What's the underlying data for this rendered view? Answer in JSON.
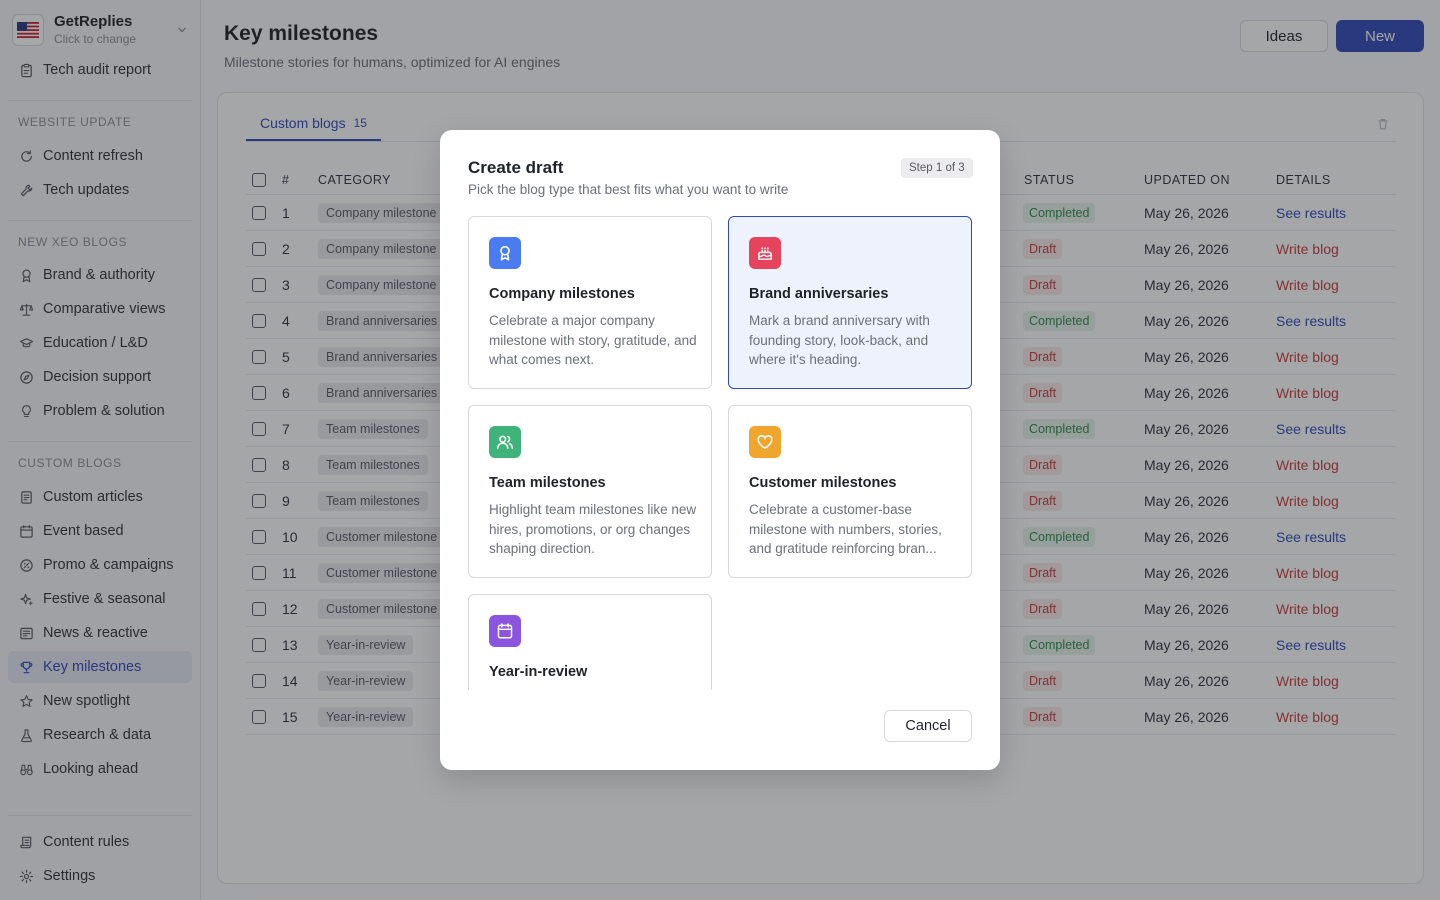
{
  "workspace": {
    "name": "GetReplies",
    "subtitle": "Click to change"
  },
  "sidebar": {
    "top_item": "Tech audit report",
    "sections": [
      {
        "title": "WEBSITE UPDATE",
        "items": [
          "Content refresh",
          "Tech updates"
        ]
      },
      {
        "title": "NEW XEO BLOGS",
        "items": [
          "Brand & authority",
          "Comparative views",
          "Education / L&D",
          "Decision support",
          "Problem & solution"
        ]
      },
      {
        "title": "CUSTOM BLOGS",
        "items": [
          "Custom articles",
          "Event based",
          "Promo & campaigns",
          "Festive & seasonal",
          "News & reactive",
          "Key milestones",
          "New spotlight",
          "Research & data",
          "Looking ahead"
        ]
      }
    ],
    "footer": [
      "Content rules",
      "Settings"
    ],
    "active_item": "Key milestones"
  },
  "header": {
    "title": "Key milestones",
    "subtitle": "Milestone stories for humans, optimized for AI engines",
    "ideas_label": "Ideas",
    "new_label": "New"
  },
  "tabs": [
    {
      "label": "Custom blogs",
      "count": "15"
    }
  ],
  "table": {
    "columns": {
      "num": "#",
      "category": "CATEGORY",
      "status": "STATUS",
      "updated": "UPDATED ON",
      "details": "DETAILS"
    },
    "rows": [
      {
        "num": "1",
        "category": "Company milestone",
        "status": "Completed",
        "updated": "May 26, 2026",
        "details": "See results"
      },
      {
        "num": "2",
        "category": "Company milestone",
        "status": "Draft",
        "updated": "May 26, 2026",
        "details": "Write blog"
      },
      {
        "num": "3",
        "category": "Company milestone",
        "status": "Draft",
        "updated": "May 26, 2026",
        "details": "Write blog"
      },
      {
        "num": "4",
        "category": "Brand anniversaries",
        "status": "Completed",
        "updated": "May 26, 2026",
        "details": "See results"
      },
      {
        "num": "5",
        "category": "Brand anniversaries",
        "status": "Draft",
        "updated": "May 26, 2026",
        "details": "Write blog"
      },
      {
        "num": "6",
        "category": "Brand anniversaries",
        "status": "Draft",
        "updated": "May 26, 2026",
        "details": "Write blog"
      },
      {
        "num": "7",
        "category": "Team milestones",
        "status": "Completed",
        "updated": "May 26, 2026",
        "details": "See results"
      },
      {
        "num": "8",
        "category": "Team milestones",
        "status": "Draft",
        "updated": "May 26, 2026",
        "details": "Write blog"
      },
      {
        "num": "9",
        "category": "Team milestones",
        "status": "Draft",
        "updated": "May 26, 2026",
        "details": "Write blog"
      },
      {
        "num": "10",
        "category": "Customer milestone",
        "status": "Completed",
        "updated": "May 26, 2026",
        "details": "See results"
      },
      {
        "num": "11",
        "category": "Customer milestone",
        "status": "Draft",
        "updated": "May 26, 2026",
        "details": "Write blog"
      },
      {
        "num": "12",
        "category": "Customer milestone",
        "status": "Draft",
        "updated": "May 26, 2026",
        "details": "Write blog"
      },
      {
        "num": "13",
        "category": "Year-in-review",
        "status": "Completed",
        "updated": "May 26, 2026",
        "details": "See results"
      },
      {
        "num": "14",
        "category": "Year-in-review",
        "status": "Draft",
        "updated": "May 26, 2026",
        "details": "Write blog"
      },
      {
        "num": "15",
        "category": "Year-in-review",
        "status": "Draft",
        "updated": "May 26, 2026",
        "details": "Write blog"
      }
    ]
  },
  "modal": {
    "title": "Create draft",
    "subtitle": "Pick the blog type that best fits what you want to write",
    "step": "Step 1 of 3",
    "cancel_label": "Cancel",
    "selected": "Brand anniversaries",
    "options": [
      {
        "title": "Company milestones",
        "description": "Celebrate a major company milestone with story, gratitude, and what comes next.",
        "icon": "award-icon",
        "color": "#4a7cf0"
      },
      {
        "title": "Brand anniversaries",
        "description": "Mark a brand anniversary with founding story, look-back, and where it's heading.",
        "icon": "cake-icon",
        "color": "#e5445c"
      },
      {
        "title": "Team milestones",
        "description": "Highlight team milestones like new hires, promotions, or org changes shaping direction.",
        "icon": "users-icon",
        "color": "#3fb37a"
      },
      {
        "title": "Customer milestones",
        "description": "Celebrate a customer-base milestone with numbers, stories, and gratitude reinforcing bran...",
        "icon": "heart-icon",
        "color": "#f0a52e"
      },
      {
        "title": "Year-in-review",
        "description": "",
        "icon": "calendar-icon",
        "color": "#8b55e0"
      }
    ]
  },
  "colors": {
    "accent": "#2f4bb8",
    "completed": "#2f8a4c",
    "draft": "#c43c3c"
  }
}
